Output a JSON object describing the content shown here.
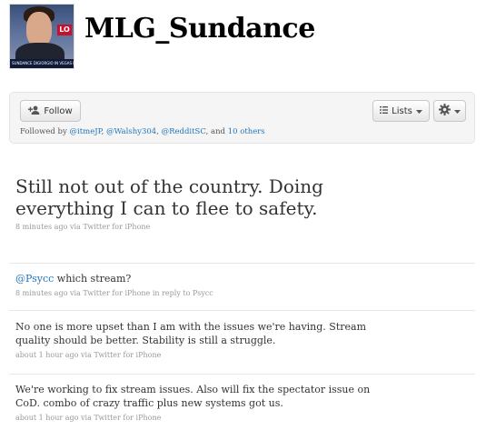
{
  "profile": {
    "screen_name": "MLG_Sundance",
    "avatar_logo": "LO",
    "avatar_ticker": "SUNDANCE DIGIORGIO IN VEGAS LAST YEAR"
  },
  "actions": {
    "follow_label": "Follow",
    "lists_label": "Lists",
    "icons": {
      "follow": "add-user-icon",
      "lists": "list-icon",
      "settings": "gear-icon",
      "caret": "caret-down-icon"
    }
  },
  "followed_by": {
    "prefix": "Followed by",
    "users": [
      "@itmeJP",
      "@Walshy304",
      "@RedditSC"
    ],
    "sep1": ", ",
    "sep2": ", ",
    "sep3": ", and ",
    "others": "10 others"
  },
  "tweets": [
    {
      "text": "Still not out of the country. Doing everything I can to flee to safety.",
      "time": "8 minutes ago",
      "via": "via",
      "source": "Twitter for iPhone"
    },
    {
      "mention": "@Psycc",
      "text": " which stream?",
      "time": "8 minutes ago",
      "via": "via",
      "source": "Twitter for iPhone",
      "reply_prefix": "in reply to",
      "reply_to": "Psycc"
    },
    {
      "text": "No one is more upset than I am with the issues we're having. Stream quality should be better. Stability is still a struggle.",
      "time": "about 1 hour ago",
      "via": "via",
      "source": "Twitter for iPhone"
    },
    {
      "text": "We're working to fix stream issues. Also will fix the spectator issue on CoD. combo of crazy traffic plus new systems got us.",
      "time": "about 1 hour ago",
      "via": "via",
      "source": "Twitter for iPhone"
    }
  ],
  "colors": {
    "link": "#2276bb",
    "meta": "#999999",
    "box_bg": "#f5f5f5"
  }
}
